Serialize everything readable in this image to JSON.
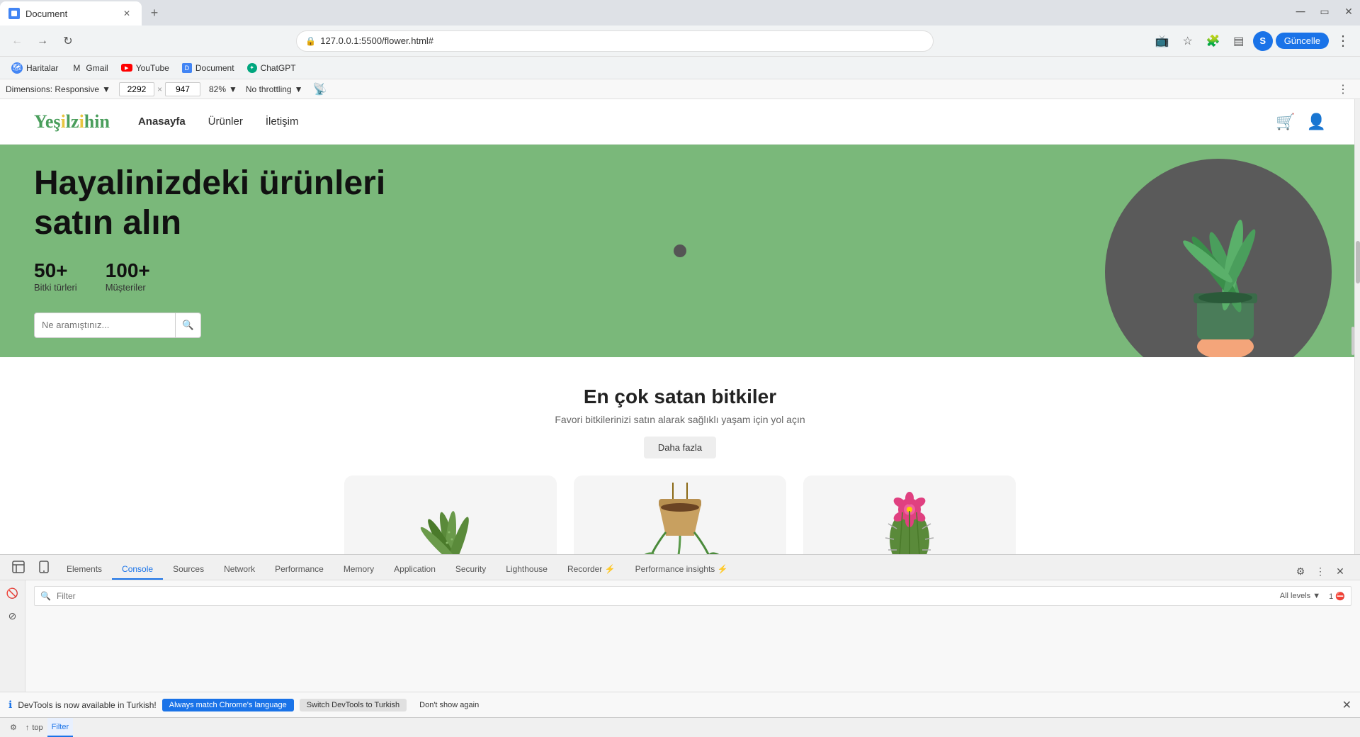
{
  "browser": {
    "tab_label": "Document",
    "tab_favicon": "doc",
    "address": "127.0.0.1:5500/flower.html#",
    "update_btn": "Güncelle",
    "profile_letter": "S"
  },
  "bookmarks": [
    {
      "id": "haritalar",
      "label": "Haritalar",
      "color": "#4285f4"
    },
    {
      "id": "gmail",
      "label": "Gmail",
      "color": "#ea4335"
    },
    {
      "id": "youtube",
      "label": "YouTube",
      "color": "#ff0000"
    },
    {
      "id": "document",
      "label": "Document",
      "color": "#4285f4"
    },
    {
      "id": "chatgpt",
      "label": "ChatGPT",
      "color": "#00a67e"
    }
  ],
  "devtools_dim_bar": {
    "dimensions_label": "Dimensions: Responsive",
    "width": "2292",
    "height": "947",
    "zoom": "82%",
    "throttle": "No throttling"
  },
  "site": {
    "logo": "Yeşilzihin",
    "nav": [
      {
        "id": "anasayfa",
        "label": "Anasayfa",
        "active": true
      },
      {
        "id": "urunler",
        "label": "Ürünler",
        "active": false
      },
      {
        "id": "iletisim",
        "label": "İletişim",
        "active": false
      }
    ],
    "hero": {
      "title": "Hayalinizdeki ürünleri satın alın",
      "stat1_num": "50+",
      "stat1_label": "Bitki türleri",
      "stat2_num": "100+",
      "stat2_label": "Müşteriler",
      "search_placeholder": "Ne aramıştınız..."
    },
    "products": {
      "title": "En çok satan bitkiler",
      "subtitle": "Favori bitkilerinizi satın alarak sağlıklı yaşam için yol açın",
      "more_btn": "Daha fazla"
    }
  },
  "devtools": {
    "tabs": [
      {
        "id": "elements",
        "label": "Elements",
        "active": false
      },
      {
        "id": "console",
        "label": "Console",
        "active": true
      },
      {
        "id": "sources",
        "label": "Sources",
        "active": false
      },
      {
        "id": "network",
        "label": "Network",
        "active": false
      },
      {
        "id": "performance",
        "label": "Performance",
        "active": false
      },
      {
        "id": "memory",
        "label": "Memory",
        "active": false
      },
      {
        "id": "application",
        "label": "Application",
        "active": false
      },
      {
        "id": "security",
        "label": "Security",
        "active": false
      },
      {
        "id": "lighthouse",
        "label": "Lighthouse",
        "active": false
      },
      {
        "id": "recorder",
        "label": "Recorder ⚡",
        "active": false
      },
      {
        "id": "perf-insights",
        "label": "Performance insights ⚡",
        "active": false
      }
    ],
    "filter_placeholder": "Filter"
  },
  "notification": {
    "text": "DevTools is now available in Turkish!",
    "btn1": "Always match Chrome's language",
    "btn2": "Switch DevTools to Turkish",
    "btn3": "Don't show again"
  }
}
